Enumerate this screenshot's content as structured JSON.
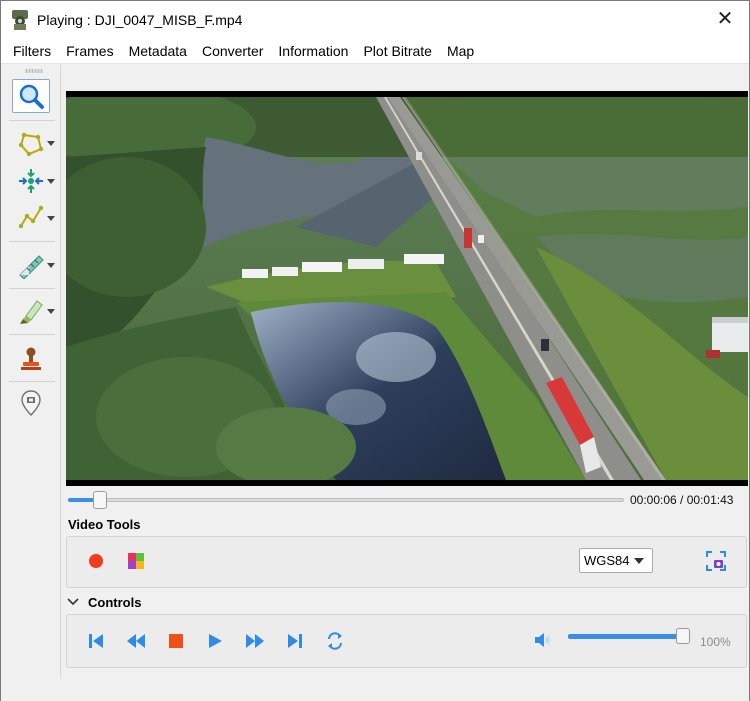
{
  "window": {
    "title": "Playing : DJI_0047_MISB_F.mp4",
    "close_glyph": "✕"
  },
  "menu": {
    "items": [
      "Filters",
      "Frames",
      "Metadata",
      "Converter",
      "Information",
      "Plot Bitrate",
      "Map"
    ]
  },
  "toolbar": {
    "tools": [
      {
        "icon": "zoom-magnifier-icon",
        "active": true,
        "dropdown": false
      },
      {
        "icon": "polygon-icon",
        "active": false,
        "dropdown": true
      },
      {
        "icon": "crosshair-move-icon",
        "active": false,
        "dropdown": true
      },
      {
        "icon": "polyline-icon",
        "active": false,
        "dropdown": true
      },
      {
        "icon": "ruler-measure-icon",
        "active": false,
        "dropdown": true
      },
      {
        "icon": "highlighter-icon",
        "active": false,
        "dropdown": true
      },
      {
        "icon": "stamp-icon",
        "active": false,
        "dropdown": false
      },
      {
        "icon": "location-pin-icon",
        "active": false,
        "dropdown": false
      }
    ]
  },
  "player": {
    "progress_fraction": 0.057,
    "current_time": "00:00:06",
    "total_time": "00:01:43",
    "time_separator": " / "
  },
  "video_tools": {
    "label": "Video Tools",
    "record_icon": "record-icon",
    "color_icon": "color-palette-icon",
    "crs_select": "WGS84",
    "capture_icon": "screen-capture-icon"
  },
  "controls": {
    "label": "Controls",
    "buttons": [
      "skip-start-icon",
      "rewind-icon",
      "stop-icon",
      "play-icon",
      "fast-forward-icon",
      "skip-end-icon",
      "loop-icon"
    ],
    "volume_percent": 100,
    "volume_label": "100%"
  },
  "colors": {
    "accent": "#2f8be6",
    "record": "#f03c1a",
    "stop": "#f04e1a"
  }
}
